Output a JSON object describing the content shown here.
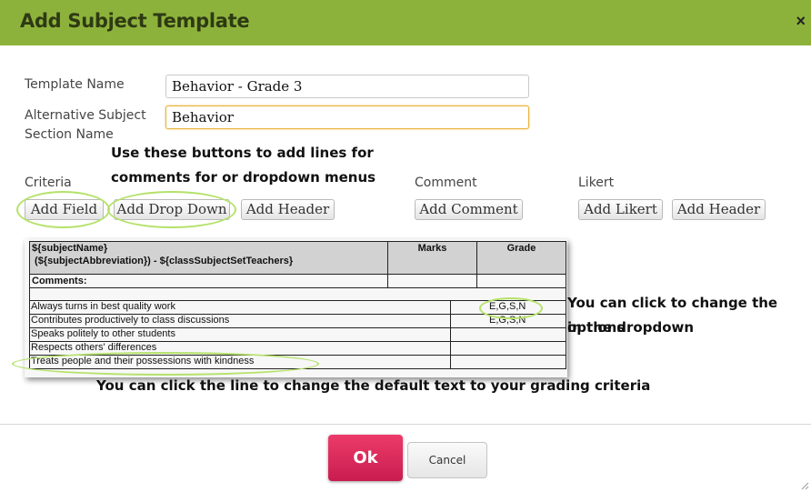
{
  "dialog": {
    "title": "Add Subject Template",
    "close_glyph": "×"
  },
  "form": {
    "template_name_label": "Template Name",
    "template_name_value": "Behavior - Grade 3",
    "alt_name_label_line1": "Alternative Subject",
    "alt_name_label_line2": "Section Name",
    "alt_name_value": "Behavior"
  },
  "annotations": {
    "buttons_note_line1": "Use these buttons to add lines for",
    "buttons_note_line2": "comments for or dropdown menus",
    "dropdown_note_line1": "You can click to change the options",
    "dropdown_note_line2": "in the dropdown",
    "line_note": "You can click the line to change the default text to your grading criteria"
  },
  "sections": {
    "criteria_label": "Criteria",
    "comment_label": "Comment",
    "likert_label": "Likert"
  },
  "buttons": {
    "add_field": "Add Field",
    "add_drop_down": "Add Drop Down",
    "add_header_criteria": "Add Header",
    "add_comment": "Add Comment",
    "add_likert": "Add Likert",
    "add_header_likert": "Add Header"
  },
  "template_table": {
    "subject_line1": "${subjectName}",
    "subject_line2": " (${subjectAbbreviation}) - ${classSubjectSetTeachers}",
    "marks_header": "Marks",
    "grade_header": "Grade",
    "comments_label": "Comments:",
    "rows": [
      {
        "text": "Always turns in best quality work",
        "grade": "E,G,S,N"
      },
      {
        "text": "Contributes productively to class discussions",
        "grade": "E,G,S,N"
      },
      {
        "text": "Speaks politely to other students",
        "grade": ""
      },
      {
        "text": "Respects others' differences",
        "grade": ""
      },
      {
        "text": "Treats people and their possessions with kindness",
        "grade": ""
      }
    ]
  },
  "footer": {
    "ok_label": "Ok",
    "cancel_label": "Cancel"
  },
  "colors": {
    "title_bar": "#8db23c",
    "highlight_ring": "#b5e26a",
    "ok_button": "#d9285a",
    "focus_border": "#e7b23a"
  }
}
